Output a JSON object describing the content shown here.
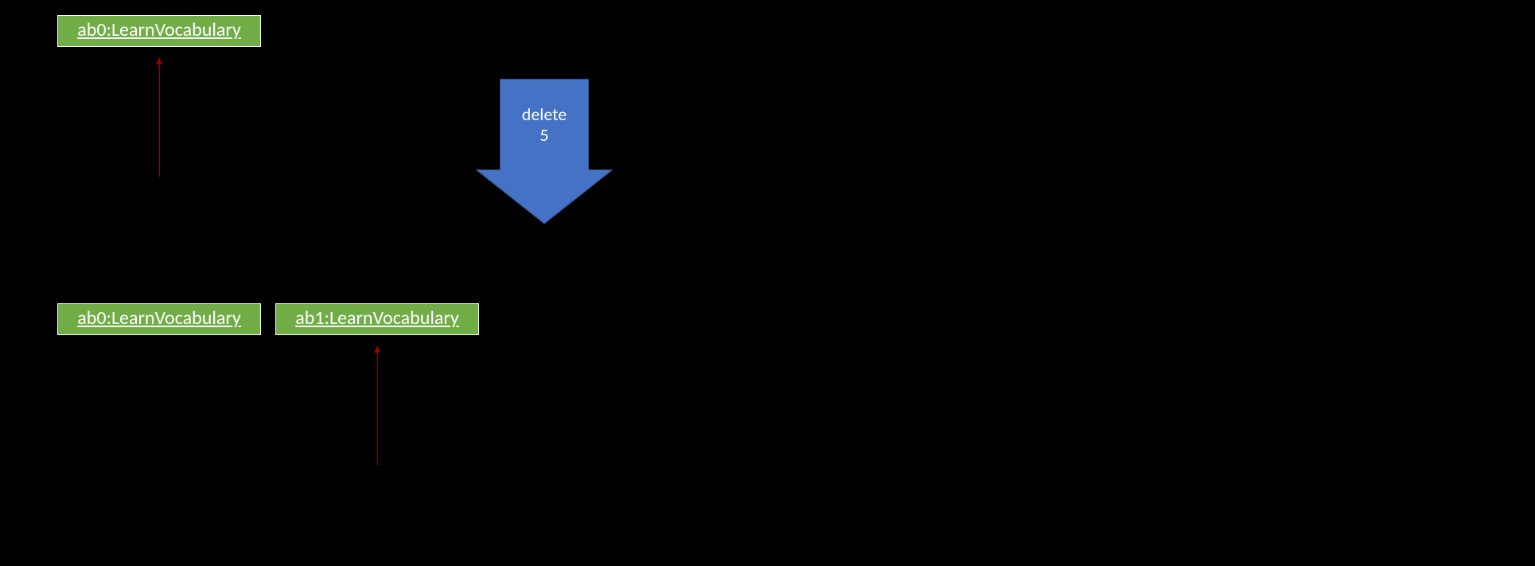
{
  "nodes": {
    "topLeft": {
      "label": "ab0:LearnVocabulary"
    },
    "bottomLeft": {
      "label": "ab0:LearnVocabulary"
    },
    "bottomRight": {
      "label": "ab1:LearnVocabulary"
    }
  },
  "operation": {
    "line1": "delete",
    "line2": "5"
  },
  "colors": {
    "nodeFill": "#70AD47",
    "nodeBorder": "#FFFFFF",
    "nodeText": "#FFFFFF",
    "smallArrow": "#990000",
    "bigArrowFill": "#4472C4",
    "bigArrowBorder": "#2F528F",
    "background": "#000000"
  }
}
